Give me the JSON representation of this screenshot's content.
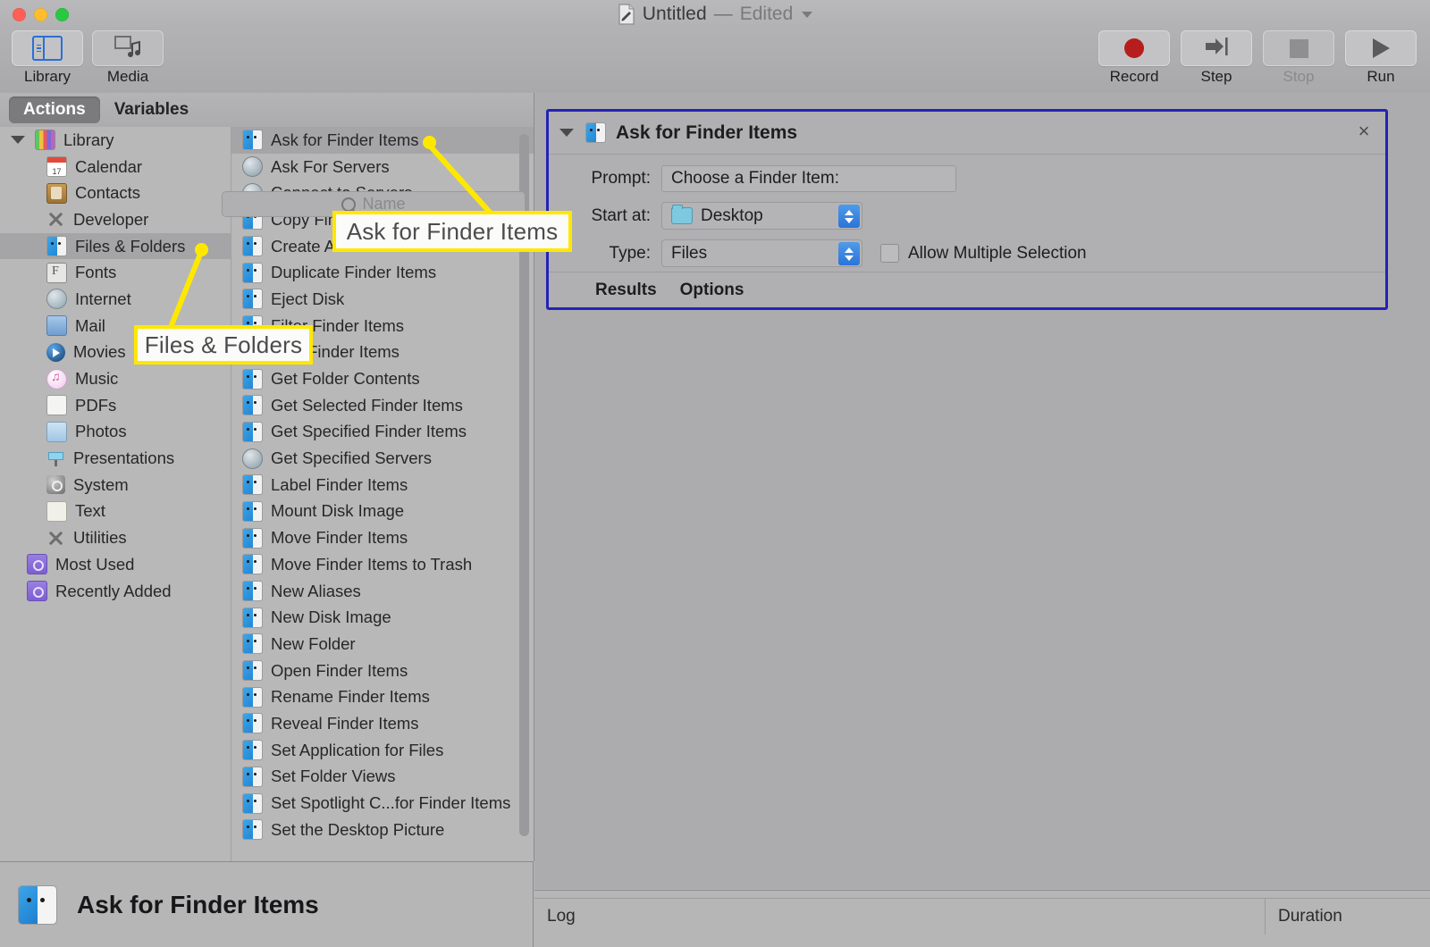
{
  "window": {
    "title": "Untitled",
    "separator": "—",
    "edited": "Edited",
    "doc_icon": "document-pencil-icon"
  },
  "toolbar": {
    "left": [
      {
        "label": "Library",
        "icon": "library-panel-icon",
        "active": true
      },
      {
        "label": "Media",
        "icon": "media-music-icon",
        "active": false
      }
    ],
    "right": [
      {
        "label": "Record",
        "icon": "record-circle-icon",
        "enabled": true
      },
      {
        "label": "Step",
        "icon": "step-arrow-icon",
        "enabled": true
      },
      {
        "label": "Stop",
        "icon": "stop-square-icon",
        "enabled": false
      },
      {
        "label": "Run",
        "icon": "run-triangle-icon",
        "enabled": true
      }
    ]
  },
  "browser": {
    "tabs": [
      {
        "label": "Actions",
        "active": true
      },
      {
        "label": "Variables",
        "active": false
      }
    ],
    "search": {
      "placeholder": "Name",
      "value": "",
      "icon": "search-icon"
    },
    "sidebar": {
      "root": {
        "label": "Library",
        "icon": "library-colors-icon",
        "expanded": true
      },
      "items": [
        {
          "label": "Calendar",
          "icon": "calendar-icon"
        },
        {
          "label": "Contacts",
          "icon": "contacts-icon"
        },
        {
          "label": "Developer",
          "icon": "developer-tools-icon"
        },
        {
          "label": "Files & Folders",
          "icon": "finder-icon",
          "selected": true
        },
        {
          "label": "Fonts",
          "icon": "fonts-icon"
        },
        {
          "label": "Internet",
          "icon": "internet-globe-icon"
        },
        {
          "label": "Mail",
          "icon": "mail-icon"
        },
        {
          "label": "Movies",
          "icon": "quicktime-movies-icon"
        },
        {
          "label": "Music",
          "icon": "music-note-icon"
        },
        {
          "label": "PDFs",
          "icon": "pdf-document-icon"
        },
        {
          "label": "Photos",
          "icon": "photos-icon"
        },
        {
          "label": "Presentations",
          "icon": "presentation-screen-icon"
        },
        {
          "label": "System",
          "icon": "system-gear-icon"
        },
        {
          "label": "Text",
          "icon": "text-pad-icon"
        },
        {
          "label": "Utilities",
          "icon": "utilities-tools-icon"
        }
      ],
      "smart_groups": [
        {
          "label": "Most Used",
          "icon": "smart-folder-icon"
        },
        {
          "label": "Recently Added",
          "icon": "smart-folder-icon"
        }
      ]
    },
    "actions": [
      {
        "label": "Ask for Finder Items",
        "icon": "finder-icon",
        "selected": true
      },
      {
        "label": "Ask For Servers",
        "icon": "server-globe-icon"
      },
      {
        "label": "Connect to Servers",
        "icon": "server-globe-icon"
      },
      {
        "label": "Copy Finder Items",
        "icon": "finder-icon"
      },
      {
        "label": "Create Archive",
        "icon": "finder-icon"
      },
      {
        "label": "Duplicate Finder Items",
        "icon": "finder-icon"
      },
      {
        "label": "Eject Disk",
        "icon": "finder-icon"
      },
      {
        "label": "Filter Finder Items",
        "icon": "finder-icon"
      },
      {
        "label": "Find Finder Items",
        "icon": "finder-icon"
      },
      {
        "label": "Get Folder Contents",
        "icon": "finder-icon"
      },
      {
        "label": "Get Selected Finder Items",
        "icon": "finder-icon"
      },
      {
        "label": "Get Specified Finder Items",
        "icon": "finder-icon"
      },
      {
        "label": "Get Specified Servers",
        "icon": "server-globe-icon"
      },
      {
        "label": "Label Finder Items",
        "icon": "finder-icon"
      },
      {
        "label": "Mount Disk Image",
        "icon": "finder-icon"
      },
      {
        "label": "Move Finder Items",
        "icon": "finder-icon"
      },
      {
        "label": "Move Finder Items to Trash",
        "icon": "finder-icon"
      },
      {
        "label": "New Aliases",
        "icon": "finder-icon"
      },
      {
        "label": "New Disk Image",
        "icon": "finder-icon"
      },
      {
        "label": "New Folder",
        "icon": "finder-icon"
      },
      {
        "label": "Open Finder Items",
        "icon": "finder-icon"
      },
      {
        "label": "Rename Finder Items",
        "icon": "finder-icon"
      },
      {
        "label": "Reveal Finder Items",
        "icon": "finder-icon"
      },
      {
        "label": "Set Application for Files",
        "icon": "finder-icon"
      },
      {
        "label": "Set Folder Views",
        "icon": "finder-icon"
      },
      {
        "label": "Set Spotlight C...for Finder Items",
        "icon": "finder-icon"
      },
      {
        "label": "Set the Desktop Picture",
        "icon": "finder-icon"
      }
    ]
  },
  "workflow": {
    "action": {
      "title": "Ask for Finder Items",
      "icon": "finder-icon",
      "disclosure": "chevron-down-icon",
      "close": "×",
      "fields": [
        {
          "name": "prompt",
          "label": "Prompt:",
          "type": "text",
          "value": "Choose a Finder Item:"
        },
        {
          "name": "start_at",
          "label": "Start at:",
          "type": "popup",
          "value": "Desktop",
          "icon": "folder-icon"
        },
        {
          "name": "type",
          "label": "Type:",
          "type": "popup",
          "value": "Files"
        }
      ],
      "checkbox": {
        "label": "Allow Multiple Selection",
        "checked": false
      },
      "footer_links": [
        "Results",
        "Options"
      ],
      "selection_color": "#2323b4"
    }
  },
  "description_bar": {
    "icon": "finder-icon",
    "title": "Ask for Finder Items"
  },
  "log_panel": {
    "columns": [
      "Log",
      "Duration"
    ]
  },
  "callouts": [
    {
      "text": "Ask for Finder Items",
      "target": "action-list-item-ask-for-finder-items",
      "color": "#ffe800"
    },
    {
      "text": "Files & Folders",
      "target": "sidebar-item-files-folders",
      "color": "#ffe800"
    }
  ]
}
